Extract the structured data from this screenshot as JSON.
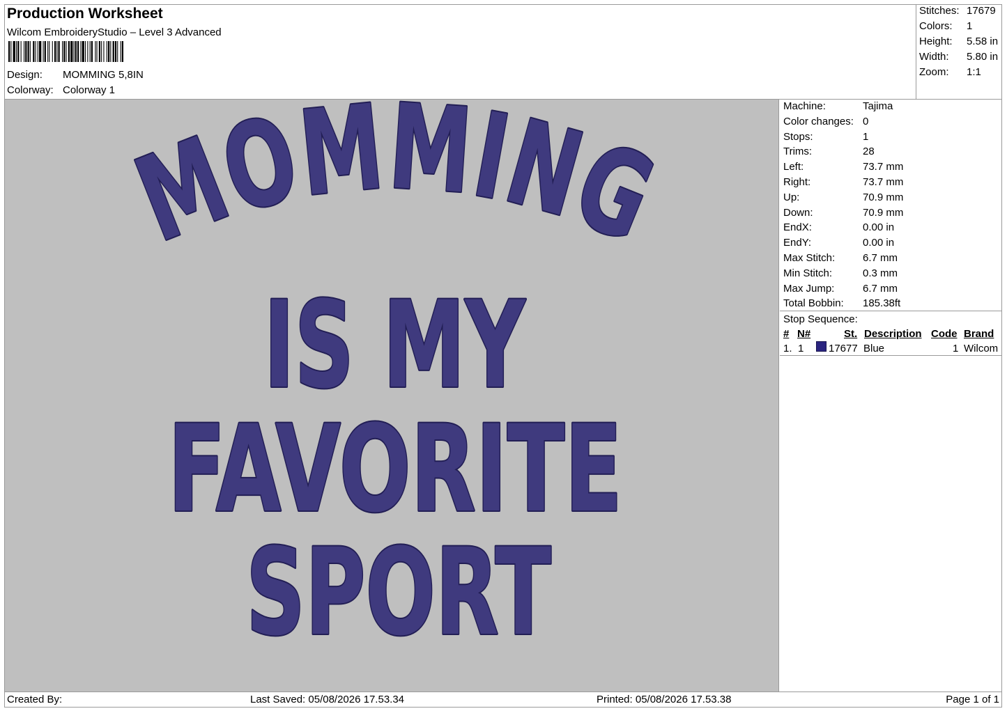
{
  "header": {
    "title": "Production Worksheet",
    "software": "Wilcom EmbroideryStudio – Level 3 Advanced",
    "design_label": "Design:",
    "design_value": "MOMMING 5,8IN",
    "colorway_label": "Colorway:",
    "colorway_value": "Colorway 1"
  },
  "stats": [
    {
      "label": "Stitches:",
      "value": "17679"
    },
    {
      "label": "Colors:",
      "value": "1"
    },
    {
      "label": "Height:",
      "value": "5.58 in"
    },
    {
      "label": "Width:",
      "value": "5.80 in"
    },
    {
      "label": "Zoom:",
      "value": "1:1"
    }
  ],
  "machine_info": [
    {
      "label": "Machine:",
      "value": "Tajima"
    },
    {
      "label": "Color changes:",
      "value": "0"
    },
    {
      "label": "Stops:",
      "value": "1"
    },
    {
      "label": "Trims:",
      "value": "28"
    },
    {
      "label": "Left:",
      "value": "73.7 mm"
    },
    {
      "label": "Right:",
      "value": "73.7 mm"
    },
    {
      "label": "Up:",
      "value": "70.9 mm"
    },
    {
      "label": "Down:",
      "value": "70.9 mm"
    },
    {
      "label": "EndX:",
      "value": "0.00 in"
    },
    {
      "label": "EndY:",
      "value": "0.00 in"
    },
    {
      "label": "Max Stitch:",
      "value": "6.7 mm"
    },
    {
      "label": "Min Stitch:",
      "value": "0.3 mm"
    },
    {
      "label": "Max Jump:",
      "value": "6.7 mm"
    },
    {
      "label": "Total Bobbin:",
      "value": "185.38ft"
    }
  ],
  "stop_sequence": {
    "title": "Stop Sequence:",
    "columns": [
      "#",
      "N#",
      "St.",
      "Description",
      "Code",
      "Brand"
    ],
    "rows": [
      {
        "index": "1.",
        "needle": "1",
        "stitches": "17677",
        "description": "Blue",
        "code": "1",
        "brand": "Wilcom",
        "color": "#2b2580"
      }
    ]
  },
  "design_text": {
    "line1": "MOMMING",
    "line2": "IS MY",
    "line3": "FAVORITE",
    "line4": "SPORT",
    "thread_color": "#3f3a7e",
    "outline_color": "#221e55",
    "background_color": "#bfbfbf"
  },
  "footer": {
    "created_by": "Created By:",
    "last_saved": "Last Saved: 05/08/2026 17.53.34",
    "printed": "Printed: 05/08/2026 17.53.38",
    "page": "Page 1 of 1"
  }
}
